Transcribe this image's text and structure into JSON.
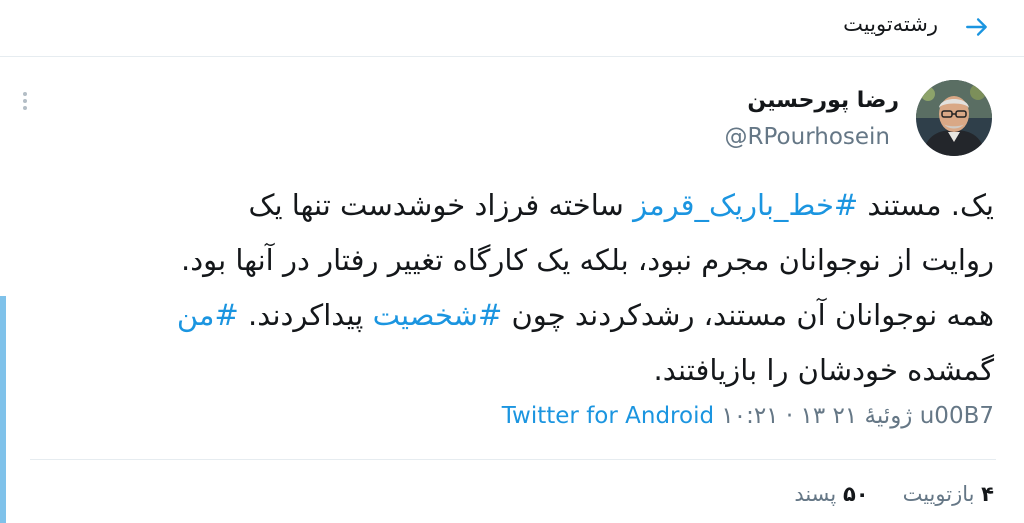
{
  "header": {
    "title": "رشته‌توییت",
    "back_icon": "arrow-right-icon"
  },
  "tweet": {
    "author_name": "رضا پورحسین",
    "author_handle": "@RPourhosein",
    "lines": [
      [
        {
          "text": "یک. مستند ",
          "hashtag": false
        },
        {
          "text": "#خط_باریک_قرمز",
          "hashtag": true
        },
        {
          "text": " ساخته فرزاد خوشدست تنها یک",
          "hashtag": false
        }
      ],
      [
        {
          "text": "روایت از نوجوانان مجرم نبود، بلکه یک کارگاه تغییر رفتار در آنها بود.",
          "hashtag": false
        }
      ],
      [
        {
          "text": "همه نوجوانان آن مستند، رشدکردند چون ",
          "hashtag": false
        },
        {
          "text": "#شخصیت",
          "hashtag": true
        },
        {
          "text": " پیداکردند. ",
          "hashtag": false
        },
        {
          "text": "#من",
          "hashtag": true
        }
      ],
      [
        {
          "text": "گمشده خودشان را بازیافتند.",
          "hashtag": false
        }
      ]
    ],
    "timestamp": "۱۰:۲۱ · ۱۳ ژوئیهٔ ۲۱ u00B7 ",
    "source": "Twitter for Android",
    "retweets_count": "۴",
    "retweets_label": "بازتوییت",
    "likes_count": "۵۰",
    "likes_label": "پسند"
  },
  "colors": {
    "accent": "#1b95e0",
    "accent_bar": "#7fc2ea",
    "secondary_text": "#657786",
    "divider": "#e6ecf0"
  },
  "icons": {
    "more": "vertical-dots-icon",
    "avatar": "user-avatar"
  }
}
